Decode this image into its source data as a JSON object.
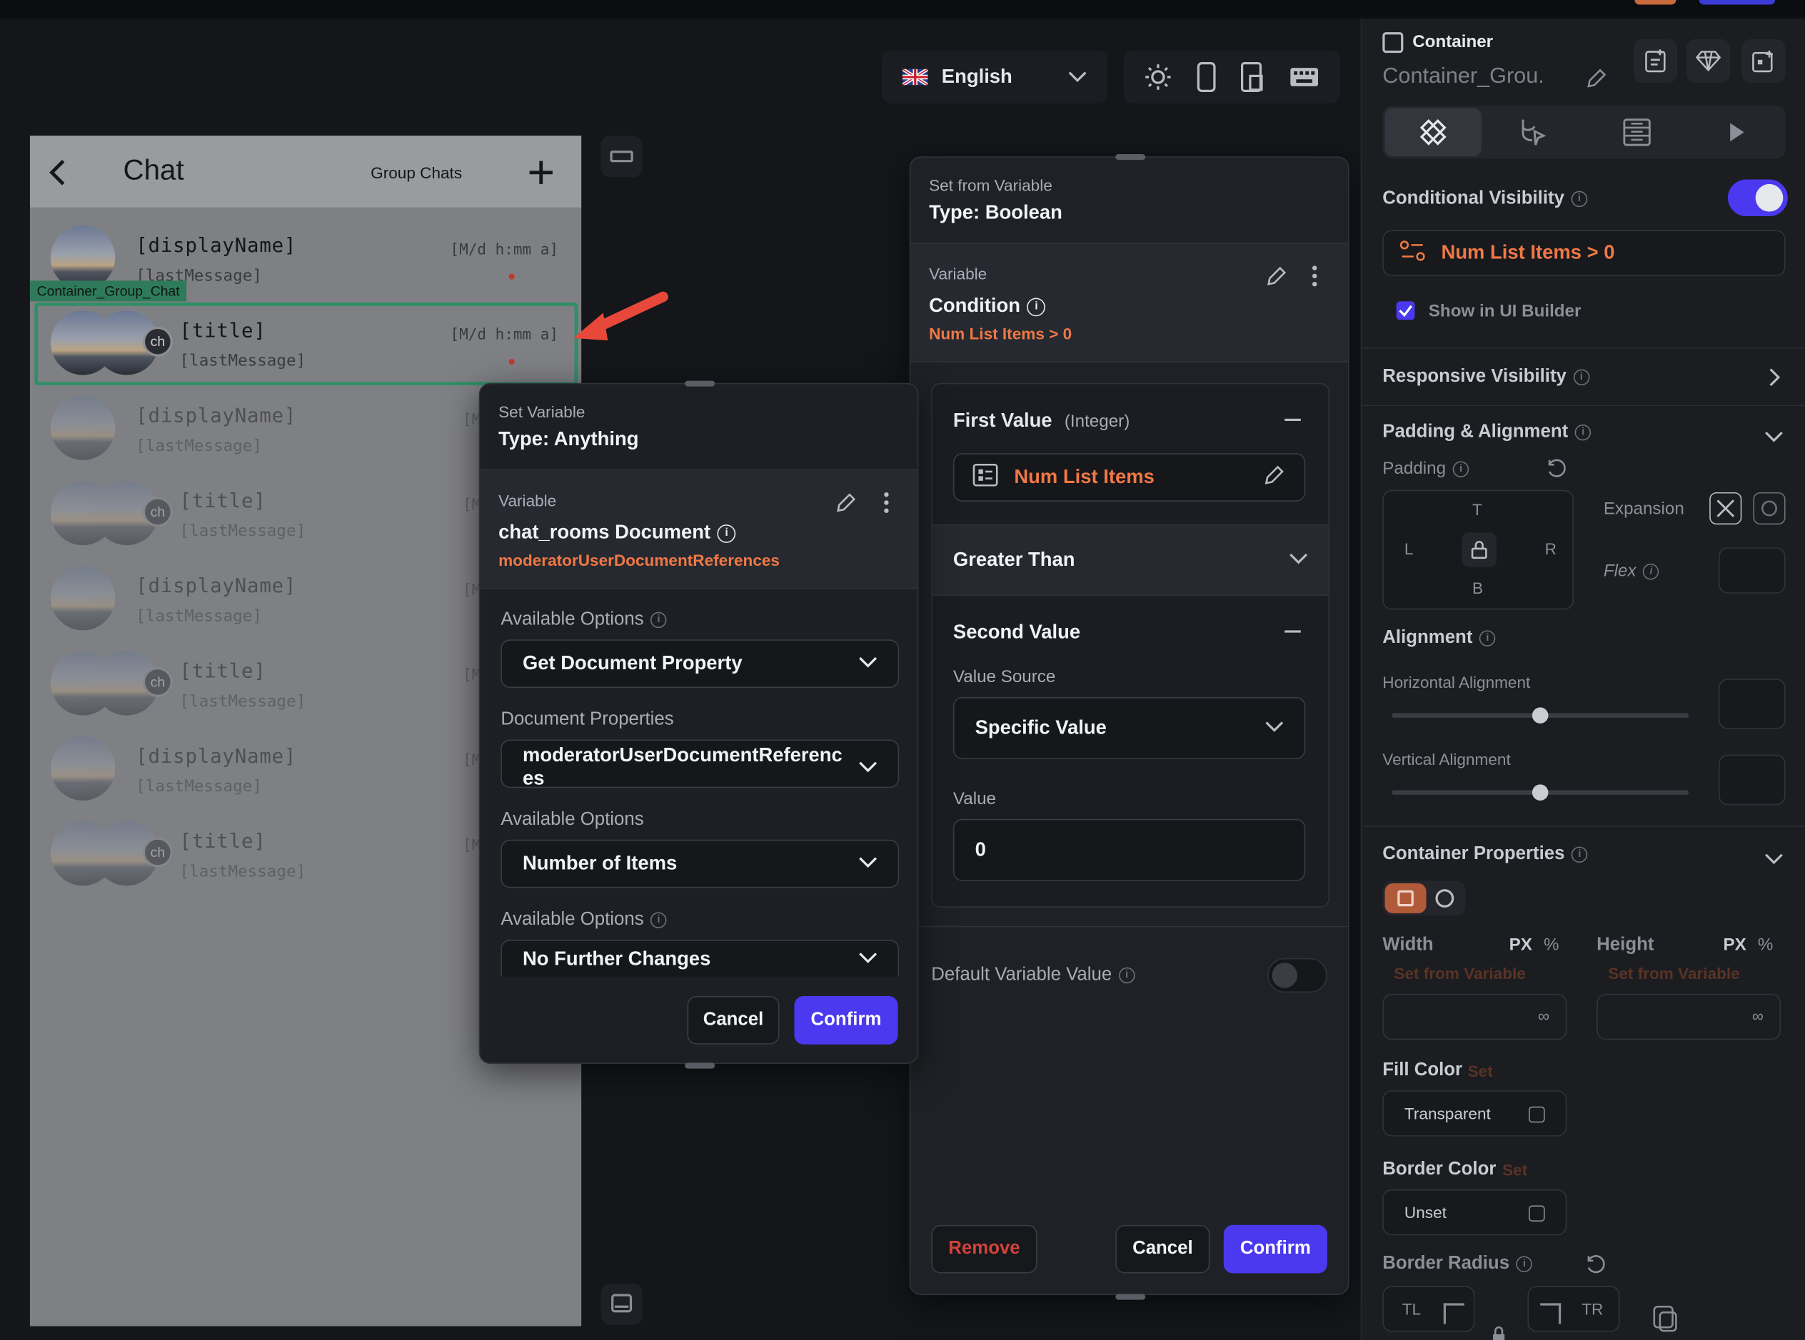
{
  "toolbar": {
    "language": "English",
    "icons": [
      "sun-icon",
      "phone-icon",
      "tablet-icon",
      "keyboard-icon"
    ]
  },
  "chat_preview": {
    "title": "Chat",
    "group_chats": "Group Chats",
    "selected_tag": "Container_Group_Chat",
    "rows": [
      {
        "name": "[displayName]",
        "sub": "[lastMessage]",
        "time": "[M/d h:mm a]",
        "type": "single"
      },
      {
        "name": "[title]",
        "sub": "[lastMessage]",
        "time": "[M/d h:mm a]",
        "type": "group",
        "badge": "ch"
      },
      {
        "name": "[displayName]",
        "sub": "[lastMessage]",
        "time": "[M",
        "type": "single"
      },
      {
        "name": "[title]",
        "sub": "[lastMessage]",
        "time": "[M",
        "type": "group",
        "badge": "ch"
      },
      {
        "name": "[displayName]",
        "sub": "[lastMessage]",
        "time": "[M",
        "type": "single"
      },
      {
        "name": "[title]",
        "sub": "[lastMessage]",
        "time": "[M",
        "type": "group",
        "badge": "ch"
      },
      {
        "name": "[displayName]",
        "sub": "[lastMessage]",
        "time": "[M",
        "type": "single"
      },
      {
        "name": "[title]",
        "sub": "[lastMessage]",
        "time": "[M",
        "type": "group",
        "badge": "ch"
      }
    ]
  },
  "set_variable": {
    "header_label": "Set Variable",
    "header_type": "Type: Anything",
    "variable_label": "Variable",
    "variable_name": "chat_rooms Document",
    "variable_path": "moderatorUserDocumentReferences",
    "opt1_label": "Available Options",
    "opt1_value": "Get Document Property",
    "docprops_label": "Document Properties",
    "docprops_value_line1": "moderatorUserDocumentReferenc",
    "docprops_value_line2": "es",
    "opt2_label": "Available Options",
    "opt2_value": "Number of Items",
    "opt3_label": "Available Options",
    "opt3_value": "No Further Changes",
    "cancel": "Cancel",
    "confirm": "Confirm"
  },
  "set_from_variable": {
    "header_label": "Set from Variable",
    "header_type": "Type: Boolean",
    "variable_label": "Variable",
    "variable_name": "Condition",
    "variable_summary_a": "Num List Items",
    "variable_summary_op": ">",
    "variable_summary_b": "0",
    "first_value_label": "First Value",
    "first_value_type": "(Integer)",
    "first_value_chip": "Num List Items",
    "operator": "Greater Than",
    "second_value_label": "Second Value",
    "value_source_label": "Value Source",
    "value_source": "Specific Value",
    "value_label": "Value",
    "value": "0",
    "default_label": "Default Variable Value",
    "remove": "Remove",
    "cancel": "Cancel",
    "confirm": "Confirm"
  },
  "props_panel": {
    "widget_type": "Container",
    "widget_name": "Container_Grou.",
    "conditional_visibility": "Conditional Visibility",
    "condition_a": "Num List Items",
    "condition_op": ">",
    "condition_b": "0",
    "show_in_builder": "Show in UI Builder",
    "responsive_visibility": "Responsive Visibility",
    "padding_alignment": "Padding & Alignment",
    "padding": "Padding",
    "pad_t": "T",
    "pad_l": "L",
    "pad_r": "R",
    "pad_b": "B",
    "expansion": "Expansion",
    "flex": "Flex",
    "alignment": "Alignment",
    "horizontal_alignment": "Horizontal Alignment",
    "vertical_alignment": "Vertical Alignment",
    "container_properties": "Container Properties",
    "width": "Width",
    "height": "Height",
    "unit_px": "PX",
    "unit_pct": "%",
    "set_from_variable": "Set from Variable",
    "infinity": "∞",
    "fill_color": "Fill Color",
    "set": "Set",
    "transparent": "Transparent",
    "border_color": "Border Color",
    "unset": "Unset",
    "border_radius": "Border Radius",
    "tl": "TL",
    "tr": "TR"
  },
  "colors": {
    "accent": "#4b39ef",
    "orange": "#f07845",
    "selection": "#2f8f67"
  }
}
